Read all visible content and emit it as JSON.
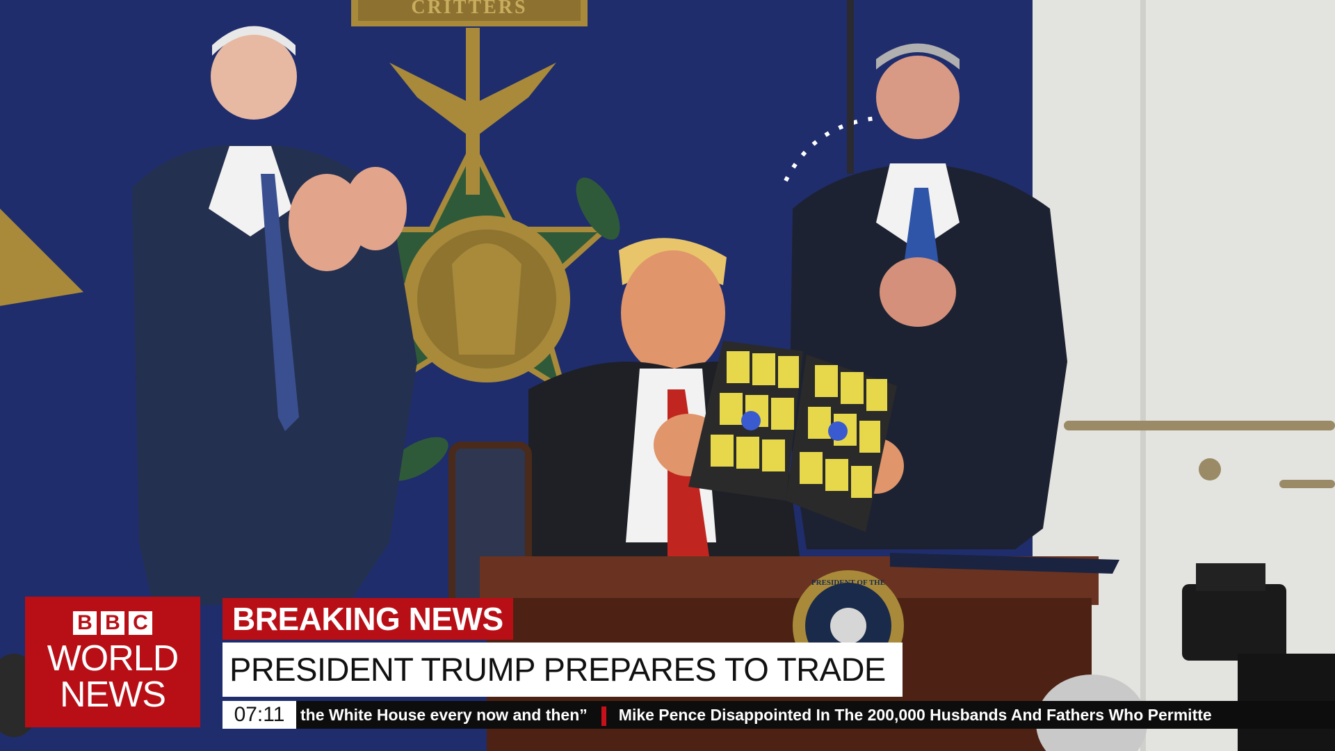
{
  "overlay": {
    "logo": {
      "letters": [
        "B",
        "B",
        "C"
      ],
      "line1": "WORLD",
      "line2": "NEWS"
    },
    "breaking_label": "BREAKING NEWS",
    "headline": "PRESIDENT TRUMP PREPARES TO TRADE",
    "ticker": {
      "time": "07:11",
      "items": [
        "the White House every now and then”",
        "Mike Pence Disappointed In The 200,000 Husbands And Fathers Who Permitte"
      ]
    },
    "plaque_text": "CRITTERS",
    "seal_text": "PRESIDENT OF THE UNITED"
  },
  "colors": {
    "bbc_red": "#b80f16",
    "ticker_bg": "#0d0d0d",
    "wall_blue": "#1c2a66",
    "wall_right": "#e4e4e0",
    "medal_gold": "#a88a3a",
    "desk_wood": "#5a2a18"
  }
}
